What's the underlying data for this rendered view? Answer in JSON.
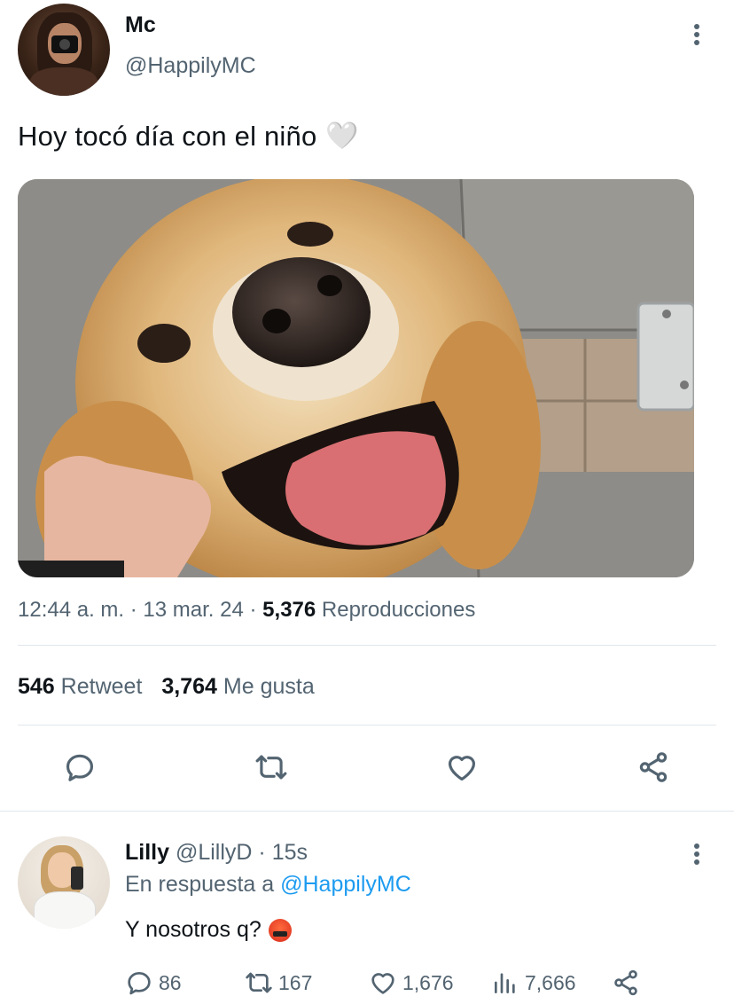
{
  "tweet": {
    "display_name": "Mc",
    "handle": "@HappilyMC",
    "text": "Hoy tocó día con el niño",
    "emoji": "🤍",
    "time": "12:44 a. m.",
    "date": "13 mar. 24",
    "views": "5,376",
    "views_label": "Reproducciones",
    "retweets": "546",
    "retweets_label": "Retweet",
    "likes": "3,764",
    "likes_label": "Me gusta",
    "separator": "·",
    "media_description": "golden retriever dog"
  },
  "actions": {
    "reply_icon": "reply-icon",
    "retweet_icon": "retweet-icon",
    "like_icon": "heart-icon",
    "share_icon": "share-icon"
  },
  "reply": {
    "display_name": "Lilly",
    "handle": "@LillyD",
    "separator": "·",
    "age": "15s",
    "reply_prefix": "En respuesta a",
    "reply_mention": "@HappilyMC",
    "text": "Y nosotros q?",
    "replies": "86",
    "retweets": "167",
    "likes": "1,676",
    "views": "7,666"
  },
  "colors": {
    "text": "#0f1419",
    "secondary": "#536471",
    "accent": "#1d9bf0",
    "divider": "#e1e6ea"
  }
}
